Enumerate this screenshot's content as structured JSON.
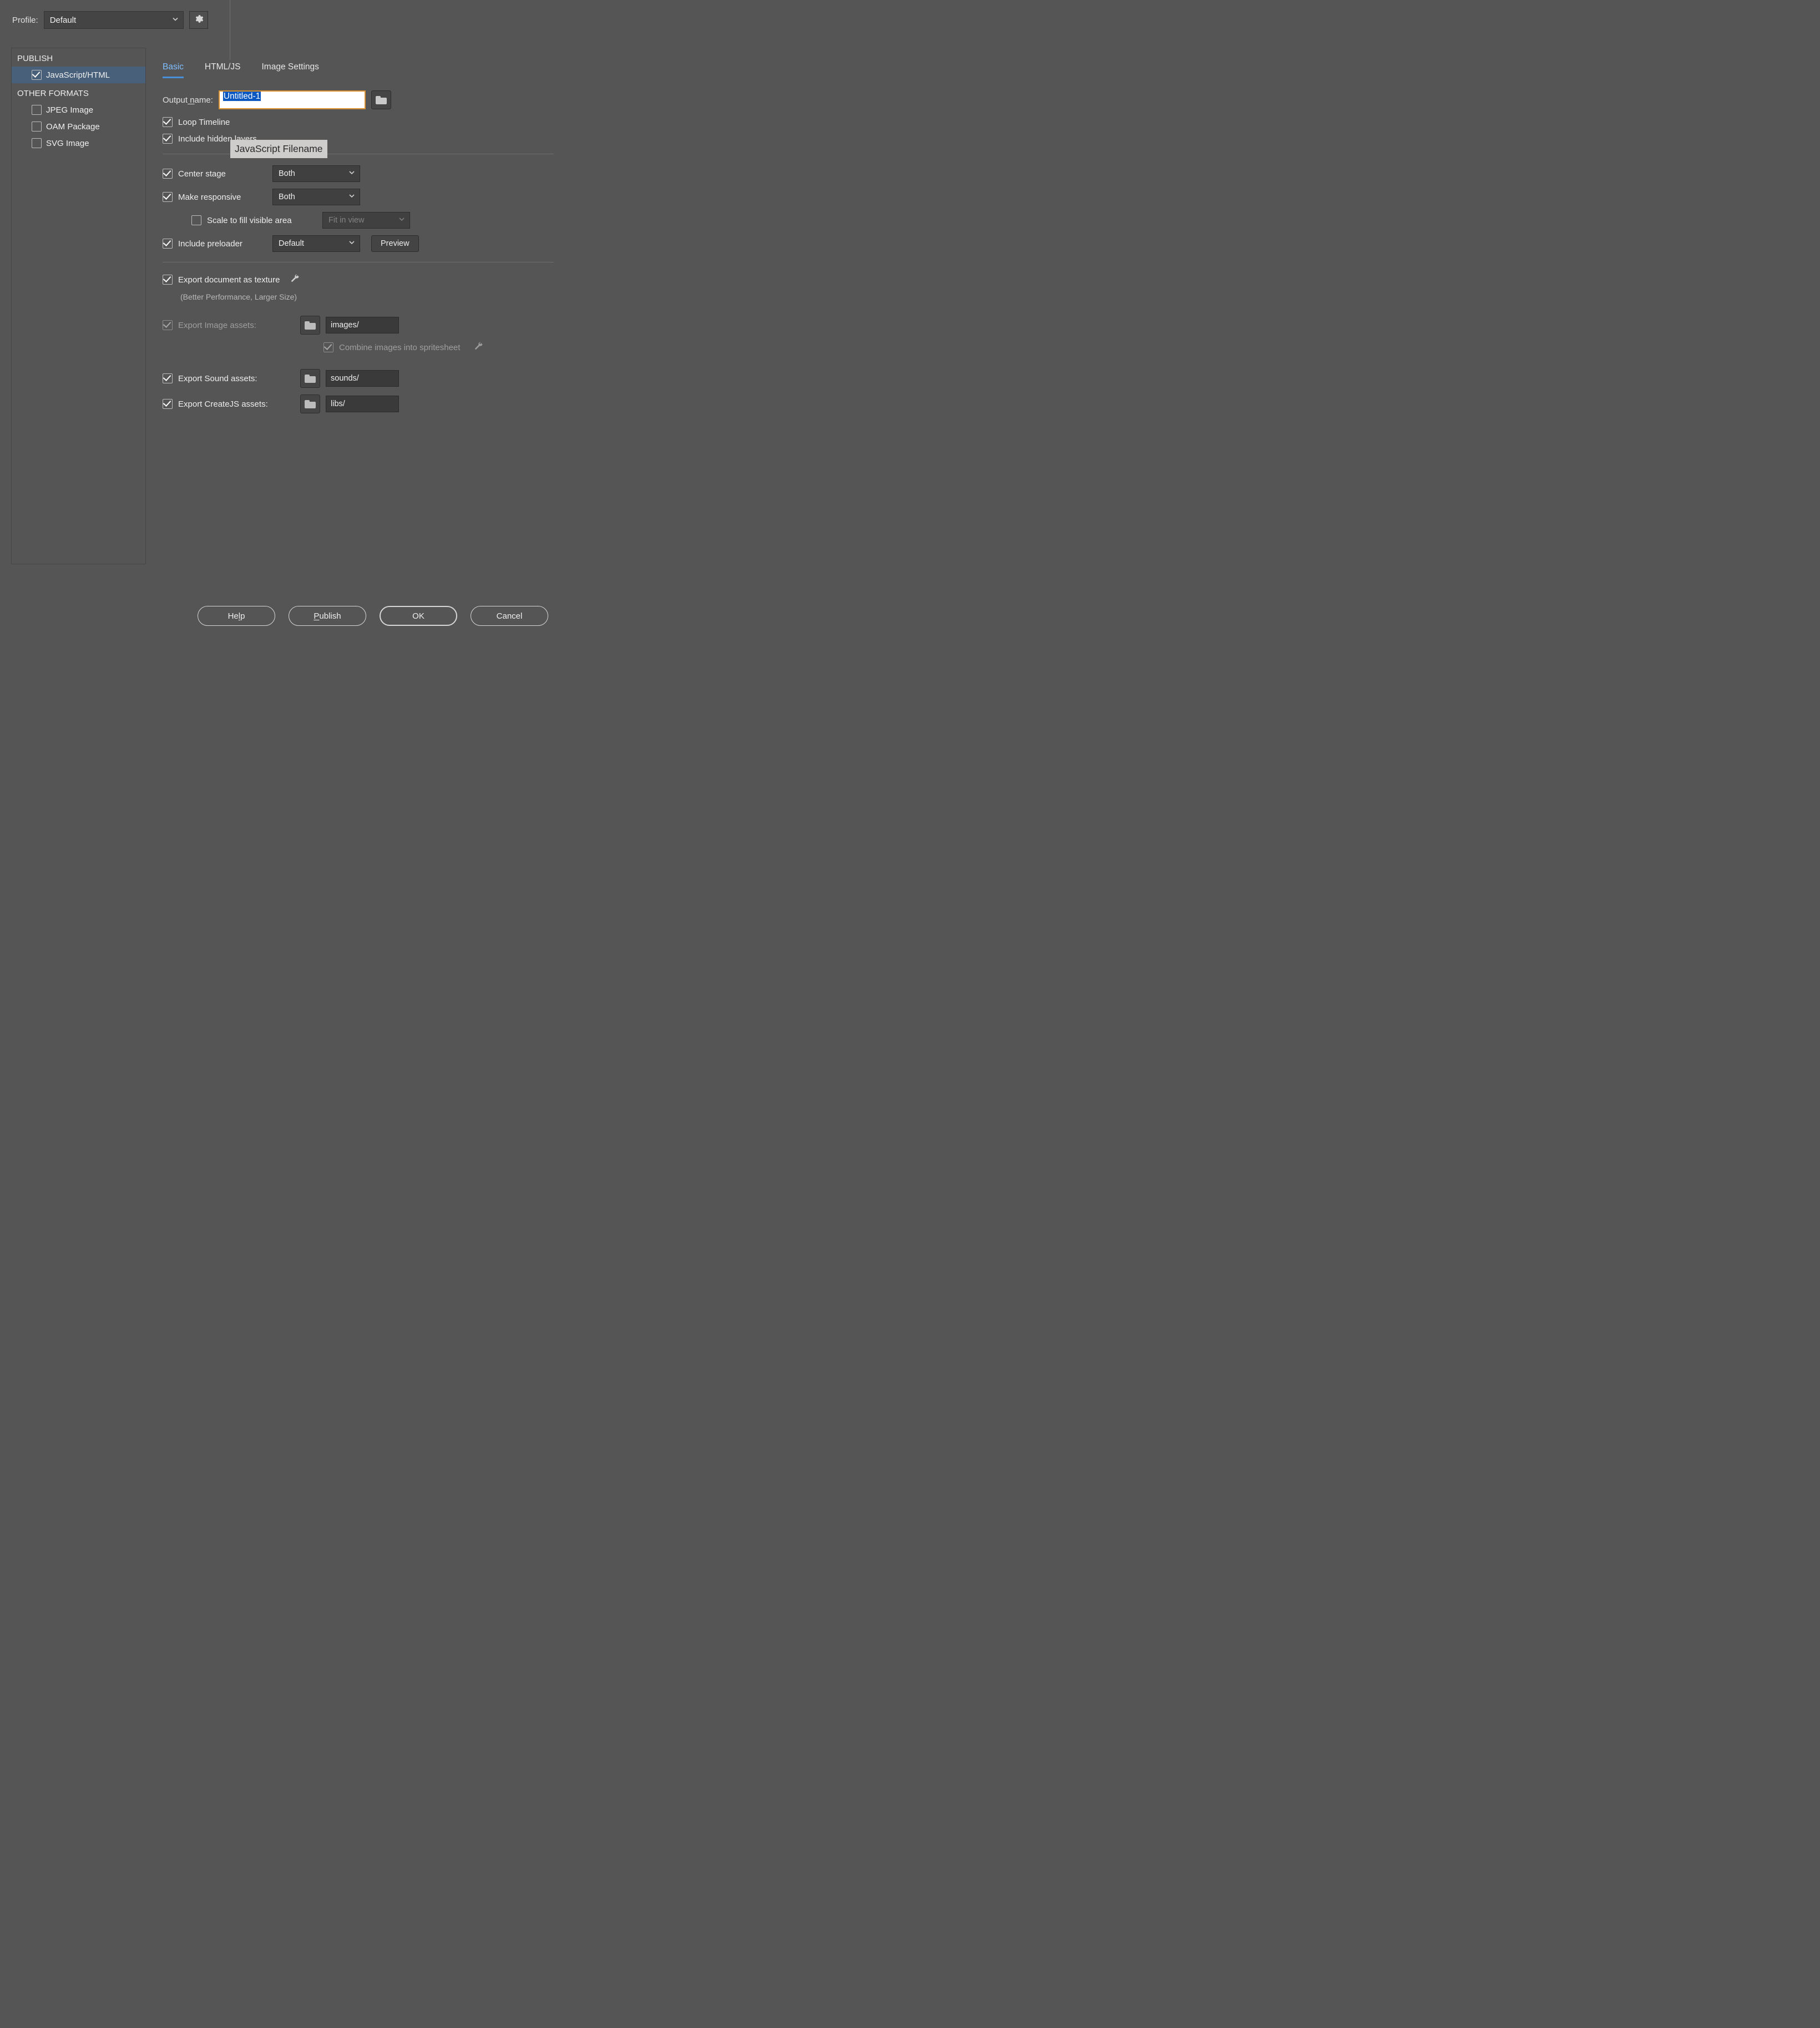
{
  "profile": {
    "label": "Profile:",
    "value": "Default"
  },
  "sidebar": {
    "publish_header": "PUBLISH",
    "other_header": "OTHER FORMATS",
    "items": {
      "jshtml": {
        "label": "JavaScript/HTML",
        "checked": true
      },
      "jpeg": {
        "label": "JPEG Image",
        "checked": false
      },
      "oam": {
        "label": "OAM Package",
        "checked": false
      },
      "svg": {
        "label": "SVG Image",
        "checked": false
      }
    }
  },
  "tabs": {
    "basic": "Basic",
    "htmljs": "HTML/JS",
    "image": "Image Settings"
  },
  "output": {
    "label": "Output name:",
    "value": "Untitled-1",
    "tooltip": "JavaScript Filename"
  },
  "options": {
    "loop_timeline": "Loop Timeline",
    "include_hidden": "Include hidden layers",
    "center_stage": {
      "label": "Center stage",
      "value": "Both"
    },
    "make_responsive": {
      "label": "Make responsive",
      "value": "Both"
    },
    "scale_fill": {
      "label": "Scale to fill visible area",
      "value": "Fit in view"
    },
    "include_preloader": {
      "label": "Include preloader",
      "value": "Default",
      "preview": "Preview"
    },
    "export_texture": {
      "label": "Export document as texture",
      "note": "(Better Performance, Larger Size)"
    },
    "export_image": {
      "label": "Export Image assets:",
      "path": "images/"
    },
    "combine_sprites": "Combine images into spritesheet",
    "export_sound": {
      "label": "Export Sound assets:",
      "path": "sounds/"
    },
    "export_createjs": {
      "label": "Export CreateJS assets:",
      "path": "libs/"
    }
  },
  "buttons": {
    "help": "Help",
    "publish": "Publish",
    "ok": "OK",
    "cancel": "Cancel"
  }
}
